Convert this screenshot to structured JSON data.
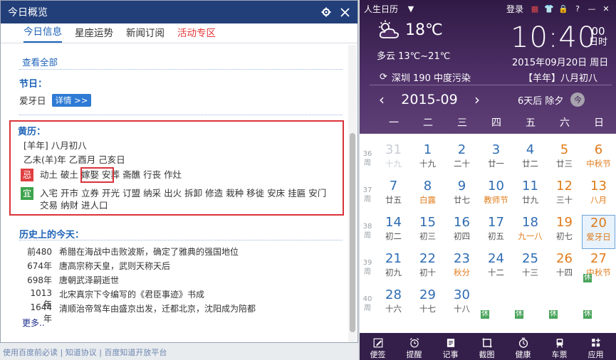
{
  "left": {
    "title": "今日概览",
    "tabs": [
      {
        "label": "今日信息",
        "state": "active"
      },
      {
        "label": "星座运势",
        "state": "normal"
      },
      {
        "label": "新闻订阅",
        "state": "normal"
      },
      {
        "label": "活动专区",
        "state": "hot"
      }
    ],
    "view_all": "查看全部",
    "festival": {
      "title": "节日：",
      "name": "爱牙日",
      "detail_btn": "详情 >>"
    },
    "almanac": {
      "title": "黄历：",
      "lunar_line": "[羊年] 八月初八",
      "ganzhi_line": "乙未(羊)年 乙酉月 己亥日",
      "ji_label": "忌",
      "ji_items": [
        "动土",
        "破土",
        "嫁娶",
        "安葬",
        "斋醮",
        "行丧",
        "作灶"
      ],
      "yi_label": "宜",
      "yi_items": [
        "入宅",
        "开市",
        "立券",
        "开光",
        "订盟",
        "纳采",
        "出火",
        "拆卸",
        "修造",
        "栽种",
        "移徙",
        "安床",
        "挂匾",
        "安门",
        "交易",
        "纳财",
        "进人口"
      ]
    },
    "history": {
      "title": "历史上的今天：",
      "items": [
        {
          "year": "前480",
          "text": "希腊在海战中击败波斯，确定了雅典的强国地位"
        },
        {
          "year": "674年",
          "text": "唐高宗称天皇，武则天称天后"
        },
        {
          "year": "698年",
          "text": "唐朝武泽嗣逝世"
        },
        {
          "year": "1013年",
          "text": "北宋真宗下令编写的《君臣事迹》书成"
        },
        {
          "year": "1644年",
          "text": "清顺治帝驾车由盛京出发，迁都北京，沈阳成为陪都"
        }
      ],
      "more": "更多.."
    },
    "below_text": "使用百度前必读 | 知道协议 | 百度知道开放平台"
  },
  "calendar": {
    "app_name": "人生日历",
    "login": "登录",
    "weather": {
      "temp": "18℃",
      "desc": "多云 13℃~21℃",
      "city_line": "深圳 190 中度污染"
    },
    "clock": {
      "time": "10:40",
      "seconds": "00",
      "sec_unit": "日时"
    },
    "date_line": "2015年09月20日 周日",
    "lunar_line": "【羊年】八月初八",
    "month": "2015-09",
    "next_festival": "6天后 除夕",
    "today_btn": "今",
    "weekdays": [
      "一",
      "二",
      "三",
      "四",
      "五",
      "六",
      "日"
    ],
    "week_suffix": "周",
    "weeks": [
      {
        "no": "36",
        "days": [
          {
            "n": "31",
            "l": "十九",
            "kind": "faded"
          },
          {
            "n": "1",
            "l": "十九",
            "kind": "normal"
          },
          {
            "n": "2",
            "l": "二十",
            "kind": "normal"
          },
          {
            "n": "3",
            "l": "廿一",
            "kind": "normal"
          },
          {
            "n": "4",
            "l": "廿二",
            "kind": "normal"
          },
          {
            "n": "5",
            "l": "廿三",
            "kind": "weekend"
          },
          {
            "n": "6",
            "l": "中秋节",
            "kind": "weekend-red"
          }
        ]
      },
      {
        "no": "37",
        "days": [
          {
            "n": "7",
            "l": "廿五",
            "kind": "normal"
          },
          {
            "n": "8",
            "l": "白露",
            "kind": "term"
          },
          {
            "n": "9",
            "l": "廿七",
            "kind": "normal"
          },
          {
            "n": "10",
            "l": "教师节",
            "kind": "term"
          },
          {
            "n": "11",
            "l": "廿九",
            "kind": "normal"
          },
          {
            "n": "12",
            "l": "三十",
            "kind": "weekend"
          },
          {
            "n": "13",
            "l": "八月",
            "kind": "weekend-red"
          }
        ]
      },
      {
        "no": "38",
        "days": [
          {
            "n": "14",
            "l": "初二",
            "kind": "normal"
          },
          {
            "n": "15",
            "l": "初三",
            "kind": "normal"
          },
          {
            "n": "16",
            "l": "初四",
            "kind": "normal"
          },
          {
            "n": "17",
            "l": "初五",
            "kind": "normal"
          },
          {
            "n": "18",
            "l": "九一八",
            "kind": "term"
          },
          {
            "n": "19",
            "l": "初七",
            "kind": "weekend"
          },
          {
            "n": "20",
            "l": "爱牙日",
            "kind": "selected"
          }
        ]
      },
      {
        "no": "39",
        "days": [
          {
            "n": "21",
            "l": "初九",
            "kind": "normal"
          },
          {
            "n": "22",
            "l": "初十",
            "kind": "normal"
          },
          {
            "n": "23",
            "l": "秋分",
            "kind": "term"
          },
          {
            "n": "24",
            "l": "十二",
            "kind": "normal"
          },
          {
            "n": "25",
            "l": "十三",
            "kind": "normal"
          },
          {
            "n": "26",
            "l": "十四",
            "kind": "weekend"
          },
          {
            "n": "27",
            "l": "中秋节",
            "kind": "weekend-red",
            "tag": "休"
          }
        ]
      },
      {
        "no": "40",
        "days": [
          {
            "n": "28",
            "l": "十六",
            "kind": "normal"
          },
          {
            "n": "29",
            "l": "十七",
            "kind": "normal"
          },
          {
            "n": "30",
            "l": "十八",
            "kind": "normal"
          },
          {
            "n": "",
            "l": "",
            "kind": "faded",
            "tag": "休"
          },
          {
            "n": "",
            "l": "",
            "kind": "faded",
            "tag": "休"
          },
          {
            "n": "",
            "l": "",
            "kind": "faded",
            "tag": "休"
          },
          {
            "n": "",
            "l": "",
            "kind": "faded",
            "tag": "休"
          }
        ]
      }
    ],
    "tools": [
      {
        "label": "便签",
        "icon": "pencil-icon"
      },
      {
        "label": "提醒",
        "icon": "alarm-icon"
      },
      {
        "label": "记事",
        "icon": "note-icon"
      },
      {
        "label": "截图",
        "icon": "crop-icon"
      },
      {
        "label": "健康",
        "icon": "clock-icon"
      },
      {
        "label": "车票",
        "icon": "train-icon"
      },
      {
        "label": "应用",
        "icon": "apps-icon"
      }
    ],
    "colors": {
      "header_dark": "#301a45",
      "accent_blue": "#1e63b8",
      "weekend_orange": "#e07b1a",
      "red": "#e4393c",
      "green": "#48a35a"
    }
  }
}
